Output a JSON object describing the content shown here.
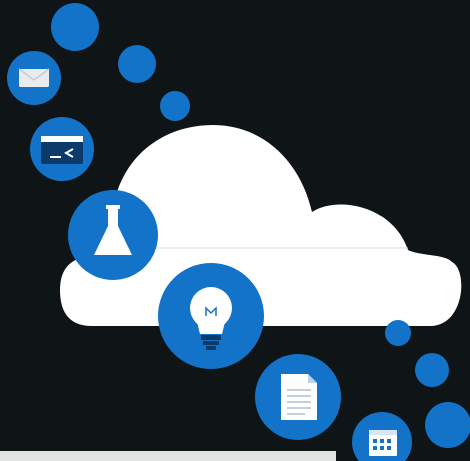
{
  "illustration": {
    "subject": "cloud-services",
    "icons": [
      "mail-icon",
      "terminal-icon",
      "lab-flask-icon",
      "lightbulb-icon",
      "document-icon",
      "calendar-icon"
    ]
  },
  "colors": {
    "background": "#0f1416",
    "cloud": "#ffffff",
    "circle": "#1373c9",
    "glyph": "#ffffff"
  }
}
